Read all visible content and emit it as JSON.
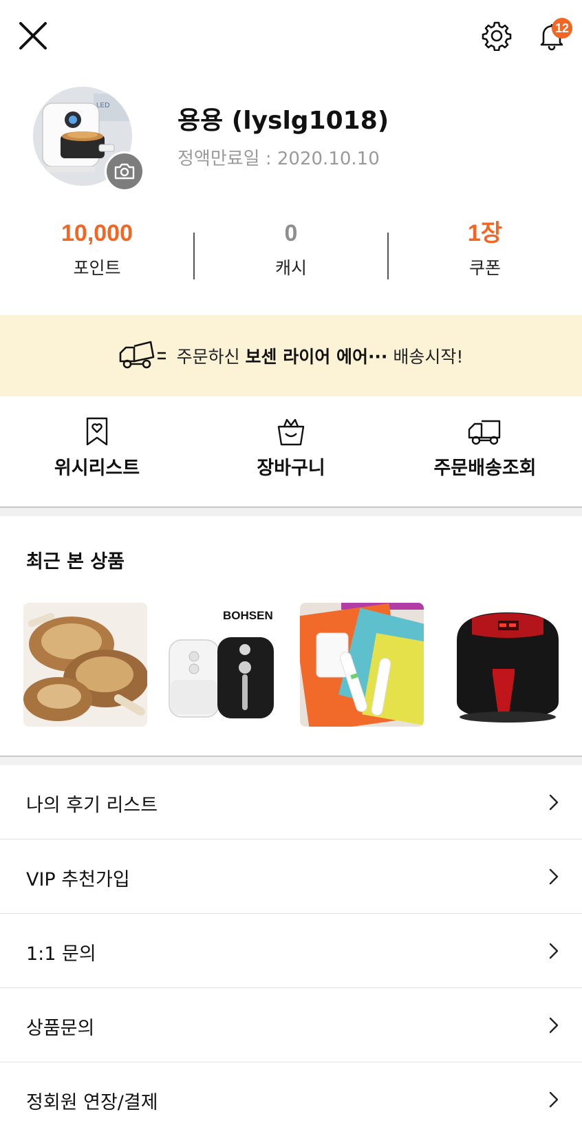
{
  "header": {
    "close_icon": "close-icon",
    "settings_icon": "gear-icon",
    "bell_icon": "bell-icon",
    "notification_count": "12"
  },
  "profile": {
    "name": "용용 (lyslg1018)",
    "expire_text": "정액만료일 : 2020.10.10",
    "avatar_icon": "avatar",
    "camera_icon": "camera-icon"
  },
  "stats": [
    {
      "value": "10,000",
      "label": "포인트",
      "color": "#f26522"
    },
    {
      "value": "0",
      "label": "캐시",
      "color": "#8e8e8e"
    },
    {
      "value": "1장",
      "label": "쿠폰",
      "color": "#f26522"
    }
  ],
  "banner": {
    "prefix": "주문하신 ",
    "product": "보센 라이어 에어···",
    "suffix": " 배송시작!",
    "icon": "delivery-truck-icon",
    "background": "#fcf3d7"
  },
  "quick_menu": [
    {
      "label": "위시리스트",
      "icon": "wishlist-bookmark-icon"
    },
    {
      "label": "장바구니",
      "icon": "shopping-bag-icon"
    },
    {
      "label": "주문배송조회",
      "icon": "delivery-truck-icon"
    }
  ],
  "recent": {
    "title": "최근 본 상품",
    "brand_text": "BOHSEN"
  },
  "menu": [
    {
      "label": "나의 후기 리스트"
    },
    {
      "label": "VIP 추천가입"
    },
    {
      "label": "1:1 문의"
    },
    {
      "label": "상품문의"
    },
    {
      "label": "정회원 연장/결제"
    }
  ],
  "colors": {
    "accent": "#f26522",
    "muted": "#9a9a9a"
  }
}
